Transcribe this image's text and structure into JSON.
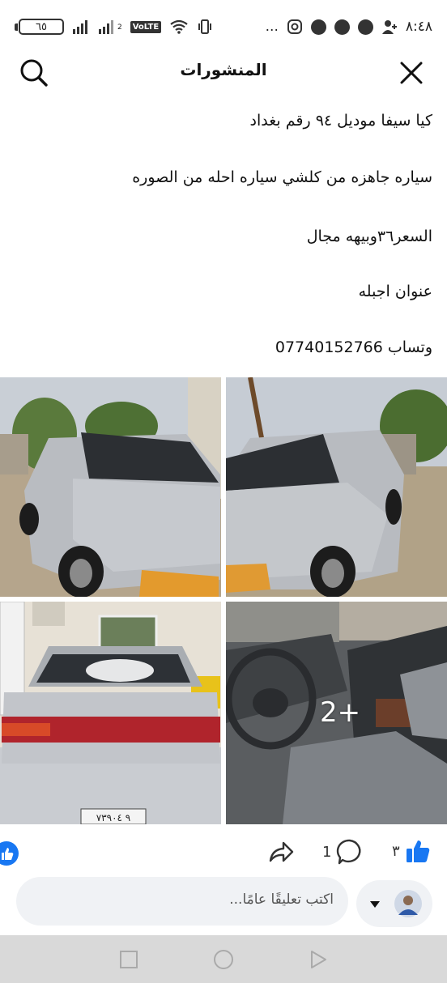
{
  "status_bar": {
    "time": "٨:٤٨",
    "battery": "٦٥",
    "network_sub": "2",
    "volte": "VoLTE",
    "more": "..."
  },
  "header": {
    "title": "المنشورات"
  },
  "post": {
    "lines": [
      "كيا سيفا موديل ٩٤ رقم بغداد",
      "سياره جاهزه من كلشي سياره احله من الصوره",
      "السعر٣٦وبيهه مجال",
      "عنوان اجبله",
      "وتساب 07740152766"
    ],
    "more_photos": "2+",
    "plate": "٩ ٧٣٩٠٤"
  },
  "actions": {
    "like_count": "٣",
    "comment_count": "1"
  },
  "comment": {
    "placeholder": "اكتب تعليقًا عامًا..."
  },
  "icons": {
    "search": "search-icon",
    "close": "close-icon",
    "like": "thumbs-up-icon",
    "comment": "comment-icon",
    "share": "share-icon",
    "dropdown": "caret-down-icon"
  },
  "colors": {
    "accent": "#1877f2",
    "comment_bg": "#f0f2f5",
    "nav_bg": "#d9d9d9"
  }
}
